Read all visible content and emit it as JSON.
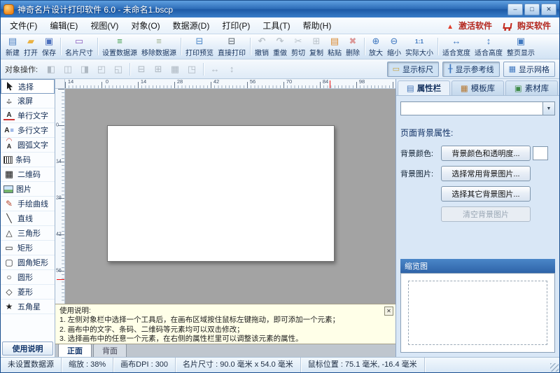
{
  "titlebar": {
    "title": "神奇名片设计打印软件 6.0 - 未命名1.bscp",
    "minimize": "–",
    "maximize": "□",
    "close": "✕"
  },
  "menubar": {
    "items": [
      "文件(F)",
      "编辑(E)",
      "视图(V)",
      "对象(O)",
      "数据源(D)",
      "打印(P)",
      "工具(T)",
      "帮助(H)"
    ],
    "activate": "激活软件",
    "buy": "购买软件"
  },
  "toolbar": {
    "items": [
      {
        "label": "新建",
        "icon": "new-document-icon"
      },
      {
        "label": "打开",
        "icon": "open-file-icon"
      },
      {
        "label": "保存",
        "icon": "save-icon"
      },
      {
        "label": "名片尺寸",
        "icon": "card-size-icon"
      },
      {
        "label": "设置数据源",
        "icon": "set-datasource-icon"
      },
      {
        "label": "移除数据源",
        "icon": "remove-datasource-icon"
      },
      {
        "label": "打印预览",
        "icon": "print-preview-icon"
      },
      {
        "label": "直接打印",
        "icon": "print-icon"
      },
      {
        "label": "撤销",
        "icon": "undo-icon",
        "disabled": true
      },
      {
        "label": "重做",
        "icon": "redo-icon",
        "disabled": true
      },
      {
        "label": "剪切",
        "icon": "cut-icon",
        "disabled": true
      },
      {
        "label": "复制",
        "icon": "copy-icon",
        "disabled": true
      },
      {
        "label": "粘贴",
        "icon": "paste-icon"
      },
      {
        "label": "删除",
        "icon": "delete-icon",
        "disabled": true
      },
      {
        "label": "放大",
        "icon": "zoom-in-icon"
      },
      {
        "label": "缩小",
        "icon": "zoom-out-icon"
      },
      {
        "label": "实际大小",
        "icon": "actual-size-icon"
      },
      {
        "label": "适合宽度",
        "icon": "fit-width-icon"
      },
      {
        "label": "适合高度",
        "icon": "fit-height-icon"
      },
      {
        "label": "整页显示",
        "icon": "fit-page-icon"
      }
    ]
  },
  "objectbar": {
    "label": "对象操作:",
    "align_icons": [
      "align-left-icon",
      "align-center-icon",
      "align-right-icon",
      "align-top-icon",
      "align-bottom-icon",
      "equal-width-icon",
      "equal-height-icon",
      "equal-size-icon",
      "same-spacing-icon",
      "distribute-h-icon",
      "distribute-v-icon"
    ],
    "toggles": [
      {
        "label": "显示标尺",
        "icon": "ruler-icon",
        "pressed": true
      },
      {
        "label": "显示参考线",
        "icon": "guides-icon",
        "pressed": true
      },
      {
        "label": "显示网格",
        "icon": "grid-icon",
        "pressed": false
      }
    ]
  },
  "tools": {
    "items": [
      {
        "label": "选择",
        "icon": "select-cursor-icon",
        "selected": true
      },
      {
        "label": "滚屏",
        "icon": "hand-pan-icon"
      },
      {
        "label": "单行文字",
        "icon": "single-line-text-icon"
      },
      {
        "label": "多行文字",
        "icon": "multi-line-text-icon"
      },
      {
        "label": "圆弧文字",
        "icon": "arc-text-icon"
      },
      {
        "label": "条码",
        "icon": "barcode-icon"
      },
      {
        "label": "二维码",
        "icon": "qrcode-icon"
      },
      {
        "label": "图片",
        "icon": "image-icon"
      },
      {
        "label": "手绘曲线",
        "icon": "freehand-curve-icon"
      },
      {
        "label": "直线",
        "icon": "line-icon"
      },
      {
        "label": "三角形",
        "icon": "triangle-icon"
      },
      {
        "label": "矩形",
        "icon": "rectangle-icon"
      },
      {
        "label": "圆角矩形",
        "icon": "rounded-rectangle-icon"
      },
      {
        "label": "圆形",
        "icon": "circle-icon"
      },
      {
        "label": "菱形",
        "icon": "diamond-icon"
      },
      {
        "label": "五角星",
        "icon": "star-icon"
      }
    ],
    "help": "使用说明"
  },
  "ruler": {
    "hlabels": [
      "14",
      "0",
      "14",
      "28",
      "42",
      "56",
      "70",
      "84",
      "98"
    ],
    "vlabels": [
      "0",
      "14",
      "28",
      "42",
      "56"
    ]
  },
  "canvas": {
    "card_color": "#ffffff"
  },
  "note": {
    "title": "使用说明:",
    "lines": [
      "1. 左侧对象栏中选择一个工具后，在画布区域按住鼠标左键拖动，即可添加一个元素；",
      "2. 画布中的文字、条码、二维码等元素均可以双击修改；",
      "3. 选择画布中的任意一个元素，在右侧的属性栏里可以调整该元素的属性。"
    ],
    "close": "✕"
  },
  "pages": {
    "front": "正面",
    "back": "背面"
  },
  "panel": {
    "tabs": [
      {
        "label": "属性栏",
        "icon": "properties-icon",
        "active": true
      },
      {
        "label": "模板库",
        "icon": "templates-icon"
      },
      {
        "label": "素材库",
        "icon": "assets-icon"
      }
    ],
    "dropdown_value": "",
    "section_title": "页面背景属性:",
    "bg_color_label": "背景颜色:",
    "bg_color_button": "背景颜色和透明度...",
    "swatch_color": "#ffffff",
    "bg_image_label": "背景图片:",
    "bg_image_button": "选择常用背景图片...",
    "bg_image_other_button": "选择其它背景图片...",
    "bg_clear_button": "清空背景图片",
    "preview_title": "缩览图"
  },
  "status": {
    "datasource": "未设置数据源",
    "zoom": "缩放 : 38%",
    "dpi": "画布DPI : 300",
    "size": "名片尺寸 : 90.0 毫米 x 54.0 毫米",
    "mouse": "鼠标位置 : 75.1 毫米, -16.4 毫米"
  }
}
